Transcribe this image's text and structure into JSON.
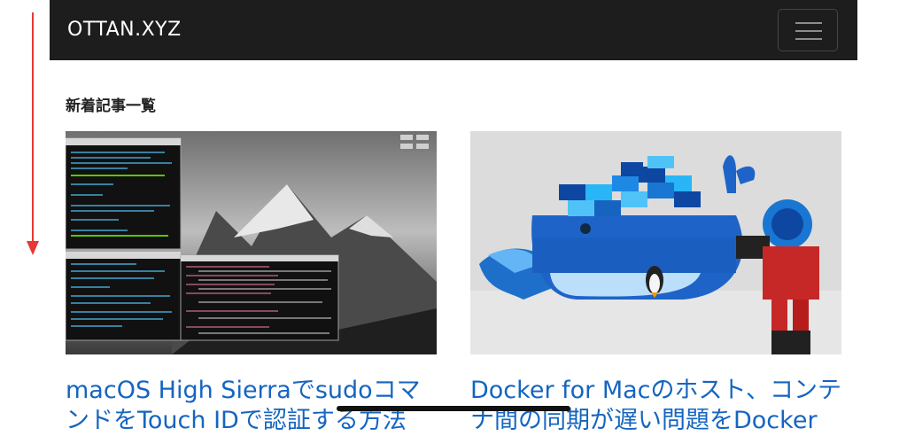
{
  "nav": {
    "brand": "OTTAN.XYZ",
    "menu_icon": "hamburger-menu-icon"
  },
  "section": {
    "title": "新着記事一覧"
  },
  "articles": [
    {
      "title": "macOS High SierraでsudoコマンドをTouch IDで認証する方法",
      "thumbnail": "terminal-windows-mountain-wallpaper"
    },
    {
      "title": "Docker for Macのホスト、コンテナ間の同期が遅い問題をDocker",
      "thumbnail": "lego-docker-whale-with-photographer"
    }
  ],
  "colors": {
    "navbar_bg": "#1d1d1d",
    "link": "#1565c0",
    "scroll_arrow": "#e53935"
  }
}
